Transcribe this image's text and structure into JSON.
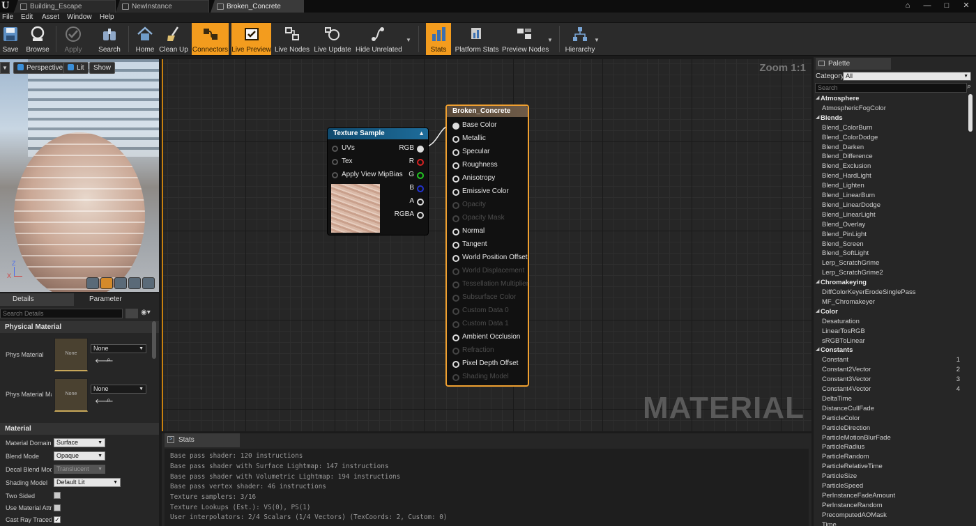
{
  "titlebar": {
    "logo": "U",
    "tabs": [
      "Building_Escape",
      "NewInstance",
      "Broken_Concrete"
    ]
  },
  "menu": [
    "File",
    "Edit",
    "Asset",
    "Window",
    "Help"
  ],
  "toolbar": {
    "save": "Save",
    "browse": "Browse",
    "apply": "Apply",
    "search": "Search",
    "home": "Home",
    "cleanup": "Clean Up",
    "connectors": "Connectors",
    "livepreview": "Live Preview",
    "livenodes": "Live Nodes",
    "liveupdate": "Live Update",
    "hideunrelated": "Hide Unrelated",
    "stats": "Stats",
    "platformstats": "Platform Stats",
    "previewnodes": "Preview Nodes",
    "hierarchy": "Hierarchy"
  },
  "viewport": {
    "perspective": "Perspective",
    "lit": "Lit",
    "show": "Show",
    "axis_z": "Z",
    "axis_x": "X"
  },
  "details": {
    "tab_details": "Details",
    "tab_params": "Parameter Defaults",
    "search_placeholder": "Search Details",
    "section_physical": "Physical Material",
    "phys_material": "Phys Material",
    "phys_material_mask": "Phys Material Ma",
    "none": "None",
    "section_material": "Material",
    "material_domain": "Material Domain",
    "material_domain_value": "Surface",
    "blend_mode": "Blend Mode",
    "blend_mode_value": "Opaque",
    "decal_blend_mode": "Decal Blend Mode",
    "decal_blend_mode_value": "Translucent",
    "shading_model": "Shading Model",
    "shading_model_value": "Default Lit",
    "two_sided": "Two Sided",
    "use_material_attributes": "Use Material Attri",
    "cast_ray_traced": "Cast Ray Traced"
  },
  "graph": {
    "zoom": "Zoom 1:1",
    "watermark": "MATERIAL",
    "texture_node": {
      "title": "Texture Sample",
      "inputs": [
        "UVs",
        "Tex",
        "Apply View MipBias"
      ],
      "outputs": [
        "RGB",
        "R",
        "G",
        "B",
        "A",
        "RGBA"
      ]
    },
    "material_node": {
      "title": "Broken_Concrete",
      "pins": [
        {
          "label": "Base Color",
          "enabled": true
        },
        {
          "label": "Metallic",
          "enabled": true
        },
        {
          "label": "Specular",
          "enabled": true
        },
        {
          "label": "Roughness",
          "enabled": true
        },
        {
          "label": "Anisotropy",
          "enabled": true
        },
        {
          "label": "Emissive Color",
          "enabled": true
        },
        {
          "label": "Opacity",
          "enabled": false
        },
        {
          "label": "Opacity Mask",
          "enabled": false
        },
        {
          "label": "Normal",
          "enabled": true
        },
        {
          "label": "Tangent",
          "enabled": true
        },
        {
          "label": "World Position Offset",
          "enabled": true
        },
        {
          "label": "World Displacement",
          "enabled": false
        },
        {
          "label": "Tessellation Multiplier",
          "enabled": false
        },
        {
          "label": "Subsurface Color",
          "enabled": false
        },
        {
          "label": "Custom Data 0",
          "enabled": false
        },
        {
          "label": "Custom Data 1",
          "enabled": false
        },
        {
          "label": "Ambient Occlusion",
          "enabled": true
        },
        {
          "label": "Refraction",
          "enabled": false
        },
        {
          "label": "Pixel Depth Offset",
          "enabled": true
        },
        {
          "label": "Shading Model",
          "enabled": false
        }
      ]
    }
  },
  "stats": {
    "tab": "Stats",
    "lines": [
      "Base pass shader: 120 instructions",
      "Base pass shader with Surface Lightmap: 147 instructions",
      "Base pass shader with Volumetric Lightmap: 194 instructions",
      "Base pass vertex shader: 46 instructions",
      "Texture samplers: 3/16",
      "Texture Lookups (Est.): VS(0), PS(1)",
      "User interpolators: 2/4 Scalars (1/4 Vectors) (TexCoords: 2, Custom: 0)"
    ]
  },
  "palette": {
    "tab": "Palette",
    "category_label": "Category:",
    "category_value": "All",
    "search_placeholder": "Search",
    "rows": [
      {
        "t": "cat",
        "label": "Atmosphere"
      },
      {
        "t": "item",
        "label": "AtmosphericFogColor"
      },
      {
        "t": "cat",
        "label": "Blends"
      },
      {
        "t": "item",
        "label": "Blend_ColorBurn"
      },
      {
        "t": "item",
        "label": "Blend_ColorDodge"
      },
      {
        "t": "item",
        "label": "Blend_Darken"
      },
      {
        "t": "item",
        "label": "Blend_Difference"
      },
      {
        "t": "item",
        "label": "Blend_Exclusion"
      },
      {
        "t": "item",
        "label": "Blend_HardLight"
      },
      {
        "t": "item",
        "label": "Blend_Lighten"
      },
      {
        "t": "item",
        "label": "Blend_LinearBurn"
      },
      {
        "t": "item",
        "label": "Blend_LinearDodge"
      },
      {
        "t": "item",
        "label": "Blend_LinearLight"
      },
      {
        "t": "item",
        "label": "Blend_Overlay"
      },
      {
        "t": "item",
        "label": "Blend_PinLight"
      },
      {
        "t": "item",
        "label": "Blend_Screen"
      },
      {
        "t": "item",
        "label": "Blend_SoftLight"
      },
      {
        "t": "item",
        "label": "Lerp_ScratchGrime"
      },
      {
        "t": "item",
        "label": "Lerp_ScratchGrime2"
      },
      {
        "t": "cat",
        "label": "Chromakeying"
      },
      {
        "t": "item",
        "label": "DiffColorKeyerErodeSinglePass"
      },
      {
        "t": "item",
        "label": "MF_Chromakeyer"
      },
      {
        "t": "cat",
        "label": "Color"
      },
      {
        "t": "item",
        "label": "Desaturation"
      },
      {
        "t": "item",
        "label": "LinearTosRGB"
      },
      {
        "t": "item",
        "label": "sRGBToLinear"
      },
      {
        "t": "cat",
        "label": "Constants"
      },
      {
        "t": "item",
        "label": "Constant",
        "num": "1"
      },
      {
        "t": "item",
        "label": "Constant2Vector",
        "num": "2"
      },
      {
        "t": "item",
        "label": "Constant3Vector",
        "num": "3"
      },
      {
        "t": "item",
        "label": "Constant4Vector",
        "num": "4"
      },
      {
        "t": "item",
        "label": "DeltaTime"
      },
      {
        "t": "item",
        "label": "DistanceCullFade"
      },
      {
        "t": "item",
        "label": "ParticleColor"
      },
      {
        "t": "item",
        "label": "ParticleDirection"
      },
      {
        "t": "item",
        "label": "ParticleMotionBlurFade"
      },
      {
        "t": "item",
        "label": "ParticleRadius"
      },
      {
        "t": "item",
        "label": "ParticleRandom"
      },
      {
        "t": "item",
        "label": "ParticleRelativeTime"
      },
      {
        "t": "item",
        "label": "ParticleSize"
      },
      {
        "t": "item",
        "label": "ParticleSpeed"
      },
      {
        "t": "item",
        "label": "PerInstanceFadeAmount"
      },
      {
        "t": "item",
        "label": "PerInstanceRandom"
      },
      {
        "t": "item",
        "label": "PrecomputedAOMask"
      },
      {
        "t": "item",
        "label": "Time"
      }
    ]
  }
}
